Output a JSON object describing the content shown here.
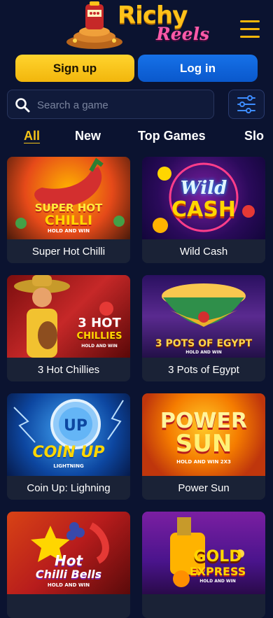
{
  "brand": {
    "name": "Richy",
    "sub": "Reels"
  },
  "auth": {
    "signup": "Sign up",
    "login": "Log in"
  },
  "search": {
    "placeholder": "Search a game"
  },
  "tabs": [
    "All",
    "New",
    "Top Games",
    "Slo"
  ],
  "games": [
    {
      "title": "Super Hot Chilli",
      "art_line1": "SUPER HOT",
      "art_line2": "CHILLI",
      "art_small": "HOLD AND WIN"
    },
    {
      "title": "Wild Cash",
      "art_line1": "Wild",
      "art_line2": "CASH",
      "art_small": ""
    },
    {
      "title": "3 Hot Chillies",
      "art_line1": "3 HOT",
      "art_line2": "CHILLIES",
      "art_small": "HOLD AND WIN"
    },
    {
      "title": "3 Pots of Egypt",
      "art_line1": "3 POTS",
      "art_line2": "OF EGYPT",
      "art_small": "HOLD AND WIN"
    },
    {
      "title": "Coin Up: Lighning",
      "art_line1": "UP",
      "art_line2": "COIN UP",
      "art_small": "LIGHTNING"
    },
    {
      "title": "Power Sun",
      "art_line1": "POWER",
      "art_line2": "SUN",
      "art_small": "HOLD AND WIN 2X3"
    },
    {
      "title": "",
      "art_line1": "Hot",
      "art_line2": "Chilli Bells",
      "art_small": "HOLD AND WIN"
    },
    {
      "title": "",
      "art_line1": "GOLD",
      "art_line2": "EXPRESS",
      "art_small": "HOLD AND WIN"
    }
  ],
  "colors": {
    "background": "#0b1330",
    "accent_yellow": "#f5c518",
    "accent_blue": "#0a58cc"
  }
}
